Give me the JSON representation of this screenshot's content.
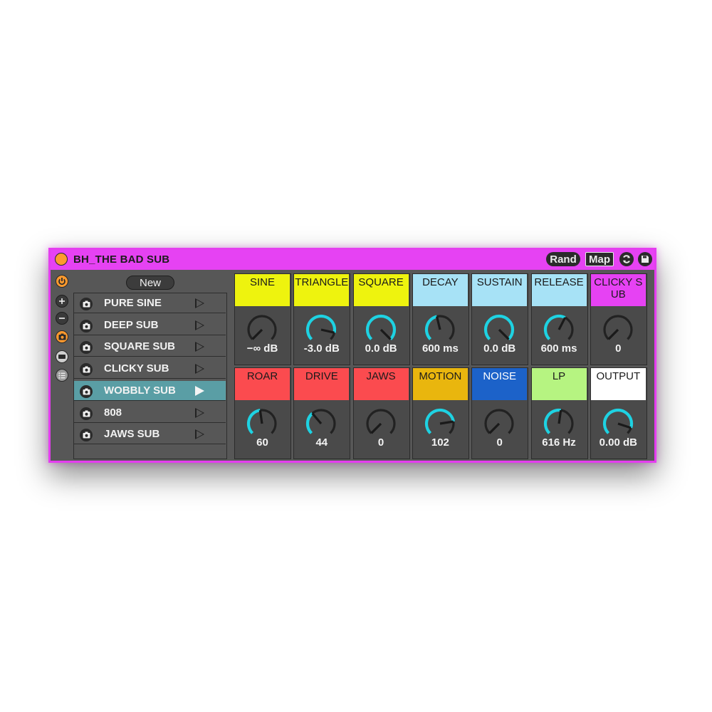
{
  "device": {
    "title": "BH_THE BAD SUB",
    "rand_label": "Rand",
    "map_label": "Map",
    "accent_color": "#e642f3",
    "fold_icon": "fold-circle-icon",
    "refresh_icon": "refresh-icon",
    "save_icon": "save-icon"
  },
  "sidebar": {
    "icons": [
      "power-icon",
      "plus-icon",
      "minus-icon",
      "camera-icon",
      "bar-icon",
      "list-icon"
    ]
  },
  "presets": {
    "new_label": "New",
    "items": [
      {
        "label": "PURE SINE"
      },
      {
        "label": "DEEP SUB"
      },
      {
        "label": "SQUARE SUB"
      },
      {
        "label": "CLICKY SUB"
      },
      {
        "label": "WOBBLY SUB",
        "selected": true
      },
      {
        "label": "808"
      },
      {
        "label": "JAWS SUB"
      }
    ]
  },
  "knobs": [
    {
      "label": "SINE",
      "value": "−∞ dB",
      "color": "#eef30e",
      "level": 0.0
    },
    {
      "label": "TRIANGLE",
      "value": "-3.0 dB",
      "color": "#eef30e",
      "level": 0.88
    },
    {
      "label": "SQUARE",
      "value": "0.0 dB",
      "color": "#eef30e",
      "level": 1.0
    },
    {
      "label": "DECAY",
      "value": "600 ms",
      "color": "#a7e2f6",
      "level": 0.45
    },
    {
      "label": "SUSTAIN",
      "value": "0.0 dB",
      "color": "#a7e2f6",
      "level": 1.0
    },
    {
      "label": "RELEASE",
      "value": "600 ms",
      "color": "#a7e2f6",
      "level": 0.6
    },
    {
      "label": "CLICKY SUB",
      "value": "0",
      "color": "#e642f3",
      "level": 0.0
    },
    {
      "label": "ROAR",
      "value": "60",
      "color": "#fb4b4f",
      "level": 0.47
    },
    {
      "label": "DRIVE",
      "value": "44",
      "color": "#fb4b4f",
      "level": 0.35
    },
    {
      "label": "JAWS",
      "value": "0",
      "color": "#fb4b4f",
      "level": 0.0
    },
    {
      "label": "MOTION",
      "value": "102",
      "color": "#e9b60e",
      "level": 0.8
    },
    {
      "label": "NOISE",
      "value": "0",
      "color": "#1c62c9",
      "level": 0.0,
      "light_text": true
    },
    {
      "label": "LP",
      "value": "616 Hz",
      "color": "#b6f481",
      "level": 0.53
    },
    {
      "label": "OUTPUT",
      "value": "0.00 dB",
      "color": "#ffffff",
      "level": 0.9
    }
  ],
  "colors": {
    "knob_arc": "#1ed2e2",
    "knob_track": "#222222"
  }
}
